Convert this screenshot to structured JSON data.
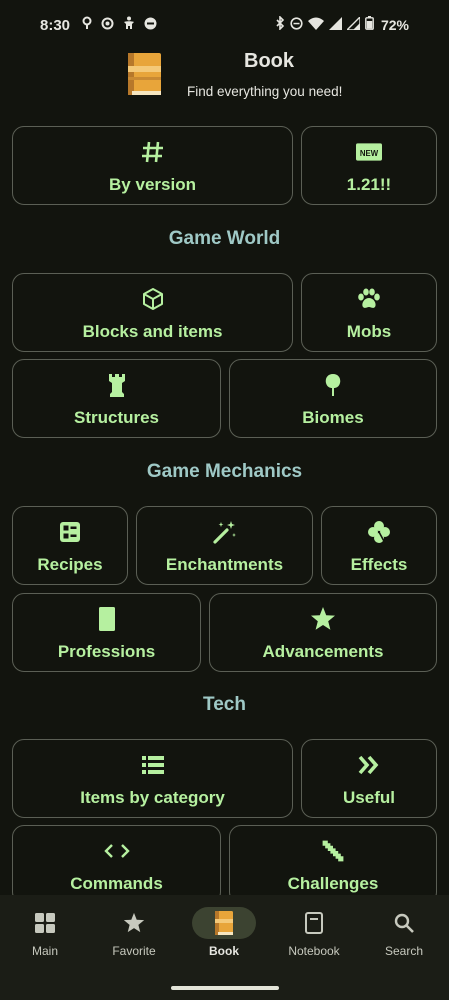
{
  "status": {
    "time": "8:30",
    "battery": "72%"
  },
  "header": {
    "title": "Book",
    "subtitle": "Find everything you need!"
  },
  "top_tiles": {
    "by_version": "By version",
    "new_version": "1.21!!"
  },
  "sections": {
    "game_world": "Game World",
    "game_mechanics": "Game Mechanics",
    "tech": "Tech"
  },
  "tiles": {
    "blocks": "Blocks and items",
    "mobs": "Mobs",
    "structures": "Structures",
    "biomes": "Biomes",
    "recipes": "Recipes",
    "enchantments": "Enchantments",
    "effects": "Effects",
    "professions": "Professions",
    "advancements": "Advancements",
    "items_by_category": "Items by category",
    "useful": "Useful",
    "commands": "Commands",
    "challenges": "Challenges"
  },
  "nav": {
    "main": "Main",
    "favorite": "Favorite",
    "book": "Book",
    "notebook": "Notebook",
    "search": "Search",
    "active": "book"
  },
  "colors": {
    "accent": "#b6f0a0",
    "section": "#9fc9c6",
    "background": "#12140e",
    "border": "#5b5f55",
    "book": "#e8a53a"
  }
}
